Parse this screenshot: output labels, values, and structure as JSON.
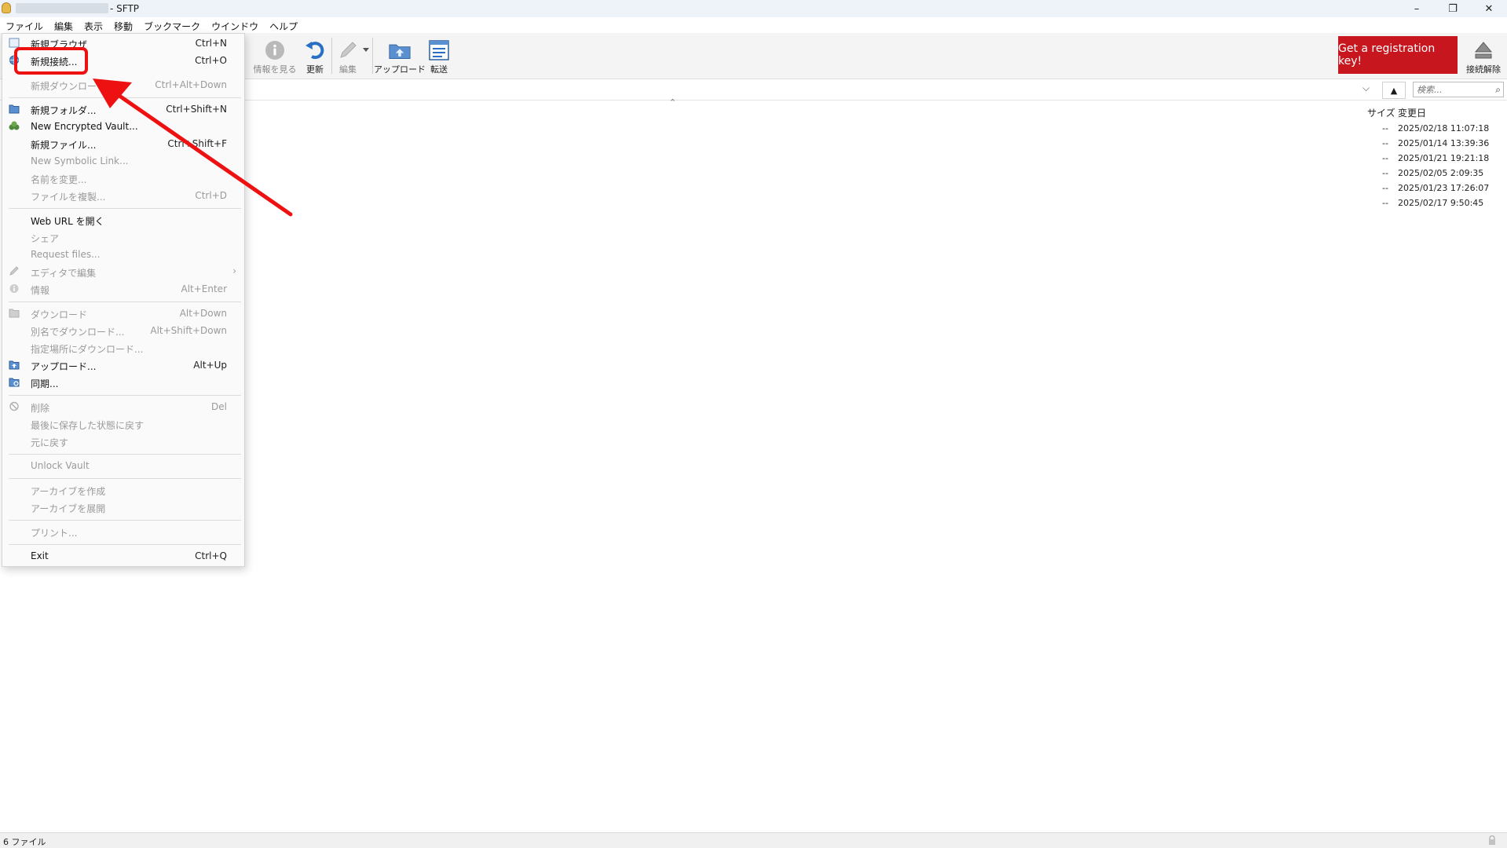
{
  "window": {
    "title_suffix": "- SFTP",
    "minimize": "–",
    "maximize": "❐",
    "close": "✕"
  },
  "menubar": [
    "ファイル",
    "編集",
    "表示",
    "移動",
    "ブックマーク",
    "ウインドウ",
    "ヘルプ"
  ],
  "toolbar": {
    "info_label": "情報を見る",
    "refresh_label": "更新",
    "edit_label": "編集",
    "upload_label": "アップロード",
    "transfer_label": "転送",
    "registration_label": "Get a registration key!",
    "disconnect_label": "接続解除"
  },
  "search": {
    "placeholder": "検索..."
  },
  "columns": {
    "size": "サイズ",
    "modified": "変更日"
  },
  "files": [
    {
      "size": "--",
      "modified": "2025/02/18 11:07:18"
    },
    {
      "size": "--",
      "modified": "2025/01/14 13:39:36"
    },
    {
      "size": "--",
      "modified": "2025/01/21 19:21:18"
    },
    {
      "size": "--",
      "modified": "2025/02/05 2:09:35"
    },
    {
      "size": "--",
      "modified": "2025/01/23 17:26:07"
    },
    {
      "size": "--",
      "modified": "2025/02/17 9:50:45"
    }
  ],
  "file_menu": [
    {
      "label": "新規ブラウザ",
      "shortcut": "Ctrl+N",
      "enabled": true
    },
    {
      "label": "新規接続...",
      "shortcut": "Ctrl+O",
      "enabled": true
    },
    {
      "label": "新規ダウンロード",
      "shortcut": "Ctrl+Alt+Down",
      "enabled": false
    },
    {
      "label": "新規フォルダ...",
      "shortcut": "Ctrl+Shift+N",
      "enabled": true
    },
    {
      "label": "New Encrypted Vault...",
      "shortcut": "",
      "enabled": true
    },
    {
      "label": "新規ファイル...",
      "shortcut": "Ctrl+Shift+F",
      "enabled": true
    },
    {
      "label": "New Symbolic Link...",
      "shortcut": "",
      "enabled": false
    },
    {
      "label": "名前を変更...",
      "shortcut": "",
      "enabled": false
    },
    {
      "label": "ファイルを複製...",
      "shortcut": "Ctrl+D",
      "enabled": false
    },
    {
      "label": "Web URL を開く",
      "shortcut": "",
      "enabled": true
    },
    {
      "label": "シェア",
      "shortcut": "",
      "enabled": false
    },
    {
      "label": "Request files...",
      "shortcut": "",
      "enabled": false
    },
    {
      "label": "エディタで編集",
      "shortcut": "",
      "enabled": false
    },
    {
      "label": "情報",
      "shortcut": "Alt+Enter",
      "enabled": false
    },
    {
      "label": "ダウンロード",
      "shortcut": "Alt+Down",
      "enabled": false
    },
    {
      "label": "別名でダウンロード...",
      "shortcut": "Alt+Shift+Down",
      "enabled": false
    },
    {
      "label": "指定場所にダウンロード...",
      "shortcut": "",
      "enabled": false
    },
    {
      "label": "アップロード...",
      "shortcut": "Alt+Up",
      "enabled": true
    },
    {
      "label": "同期...",
      "shortcut": "",
      "enabled": true
    },
    {
      "label": "削除",
      "shortcut": "Del",
      "enabled": false
    },
    {
      "label": "最後に保存した状態に戻す",
      "shortcut": "",
      "enabled": false
    },
    {
      "label": "元に戻す",
      "shortcut": "",
      "enabled": false
    },
    {
      "label": "Unlock Vault",
      "shortcut": "",
      "enabled": false
    },
    {
      "label": "アーカイブを作成",
      "shortcut": "",
      "enabled": false
    },
    {
      "label": "アーカイブを展開",
      "shortcut": "",
      "enabled": false
    },
    {
      "label": "プリント...",
      "shortcut": "",
      "enabled": false
    },
    {
      "label": "Exit",
      "shortcut": "Ctrl+Q",
      "enabled": true
    }
  ],
  "status": {
    "text": "6 ファイル"
  },
  "colors": {
    "highlight": "#ee1111",
    "registration_bg": "#c8161e",
    "toolbar_icon_blue": "#2a6fc4"
  },
  "annotation_icons": [
    "new-browser-icon",
    "new-connection-icon",
    "new-folder-icon",
    "vault-icon",
    "edit-icon",
    "info-icon",
    "download-icon",
    "upload-icon",
    "sync-icon",
    "delete-icon",
    "lock-icon"
  ]
}
